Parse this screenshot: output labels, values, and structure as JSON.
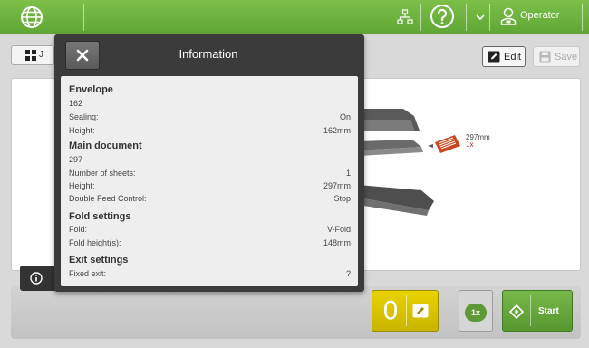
{
  "topbar": {
    "user_label": "Operator"
  },
  "toolbar": {
    "back_label": "J",
    "edit_label": "Edit",
    "save_label": "Save"
  },
  "diagram": {
    "dimension": "297mm",
    "quantity": "1x"
  },
  "popup": {
    "title": "Information",
    "envelope": {
      "title": "Envelope",
      "code": "162",
      "sealing_label": "Sealing:",
      "sealing_value": "On",
      "height_label": "Height:",
      "height_value": "162mm"
    },
    "main_document": {
      "title": "Main document",
      "code": "297",
      "sheets_label": "Number of sheets:",
      "sheets_value": "1",
      "height_label": "Height:",
      "height_value": "297mm",
      "dfc_label": "Double Feed Control:",
      "dfc_value": "Stop"
    },
    "fold_settings": {
      "title": "Fold settings",
      "fold_label": "Fold:",
      "fold_value": "V-Fold",
      "fold_height_label": "Fold height(s):",
      "fold_height_value": "148mm"
    },
    "exit_settings": {
      "title": "Exit settings",
      "fixed_exit_label": "Fixed exit:",
      "fixed_exit_value": "?"
    }
  },
  "bottom": {
    "counter_value": "0",
    "multiplier": "1x",
    "start_label": "Start"
  },
  "colors": {
    "topbar_green": "#6db33f",
    "counter_yellow": "#d9c400",
    "start_green": "#5d9a37"
  }
}
